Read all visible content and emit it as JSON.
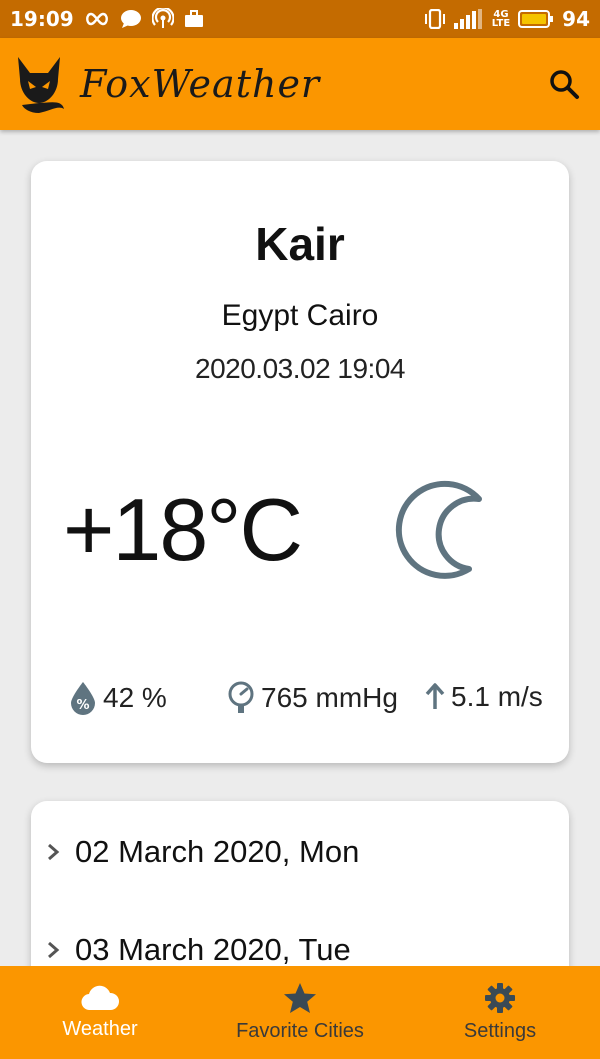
{
  "status_bar": {
    "time": "19:09",
    "network": "4G",
    "network_sub": "LTE",
    "battery": "94"
  },
  "app_bar": {
    "title": "FoxWeather"
  },
  "weather": {
    "city": "Kair",
    "country": "Egypt Cairo",
    "datetime": "2020.03.02 19:04",
    "temperature": "+18°C",
    "condition_icon": "moon-icon",
    "humidity": "42 %",
    "pressure": "765 mmHg",
    "wind": "5.1 m/s"
  },
  "forecast": [
    {
      "date": "02 March 2020, Mon"
    },
    {
      "date": "03 March 2020, Tue"
    }
  ],
  "bottom_nav": [
    {
      "label": "Weather",
      "icon": "cloud-icon",
      "active": true
    },
    {
      "label": "Favorite Cities",
      "icon": "star-icon",
      "active": false
    },
    {
      "label": "Settings",
      "icon": "gear-icon",
      "active": false
    }
  ],
  "colors": {
    "primary": "#fb9600",
    "primary_dark": "#c46b00",
    "icon_gray": "#5f7480"
  }
}
